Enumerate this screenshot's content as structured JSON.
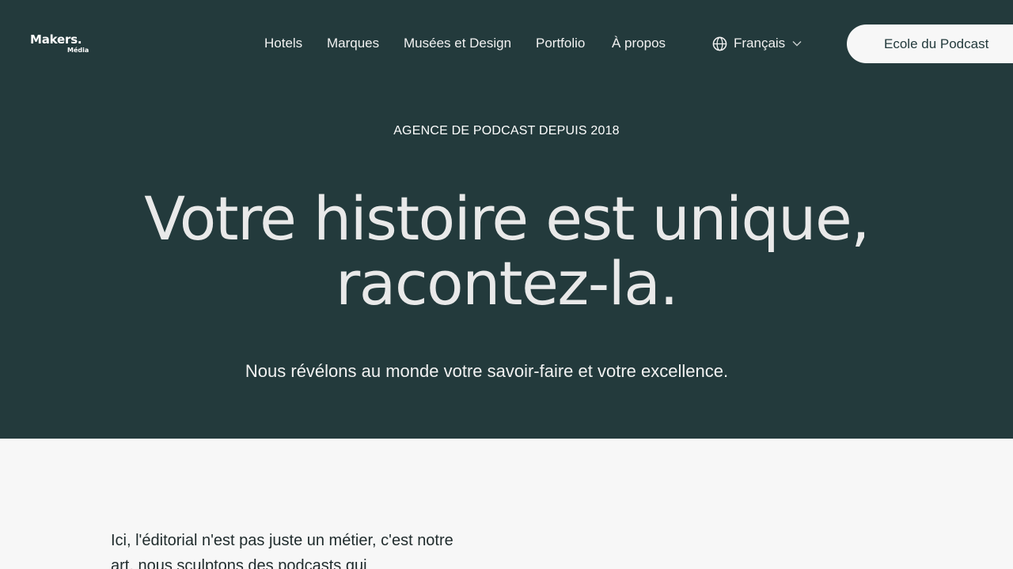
{
  "header": {
    "logo_main": "Makers.",
    "logo_sub": "Média",
    "nav": [
      {
        "label": "Hotels"
      },
      {
        "label": "Marques"
      },
      {
        "label": "Musées et Design"
      },
      {
        "label": "Portfolio"
      },
      {
        "label": "À propos"
      }
    ],
    "language": {
      "label": "Français",
      "icon": "globe-icon"
    },
    "cta_label": "Ecole du Podcast"
  },
  "hero": {
    "eyebrow": "AGENCE DE PODCAST DEPUIS 2018",
    "headline_line1": "Votre histoire est unique,",
    "headline_line2": "racontez-la.",
    "subline": "Nous révélons au monde votre savoir-faire et votre excellence."
  },
  "body": {
    "intro": "Ici, l'éditorial n'est pas juste un métier, c'est notre art, nous sculptons des podcasts qui"
  },
  "colors": {
    "hero_bg": "#233a3c",
    "page_bg": "#f7f7f7",
    "cta_bg": "#f7f7f7",
    "text_dark": "#1f2b2c"
  }
}
